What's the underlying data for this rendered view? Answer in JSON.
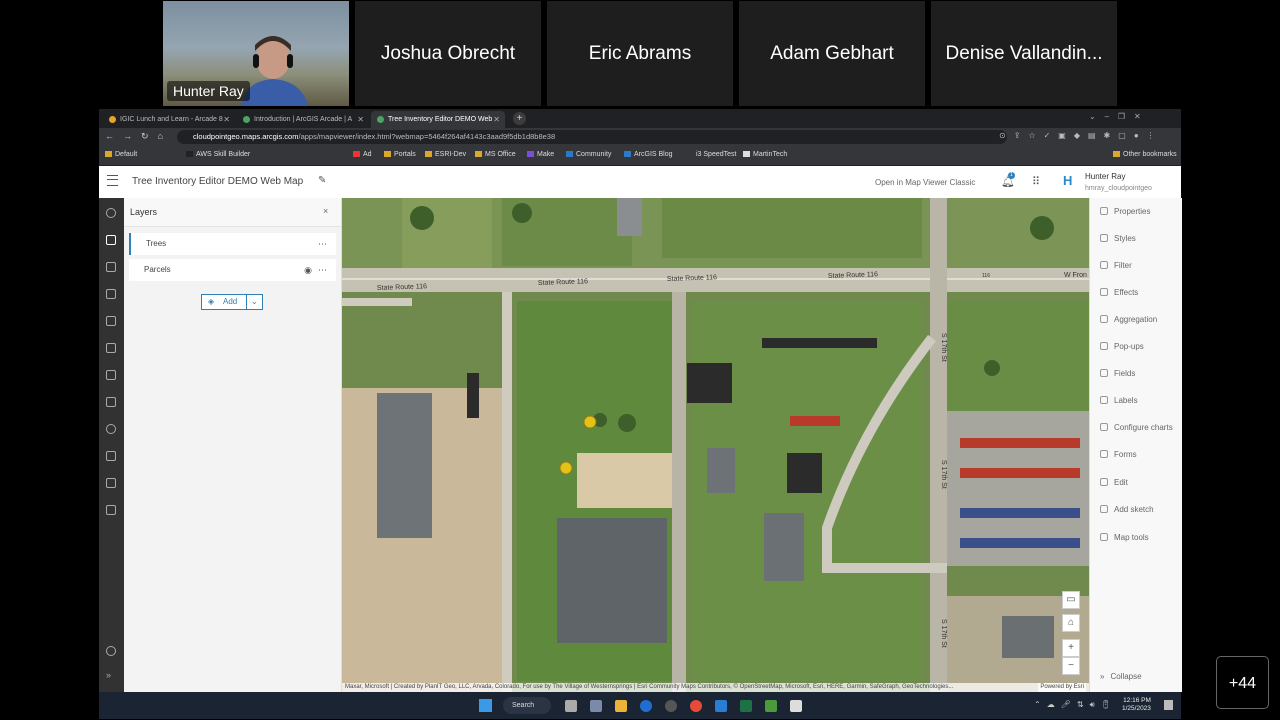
{
  "meeting": {
    "self_name": "Hunter Ray",
    "participants": [
      "Joshua Obrecht",
      "Eric Abrams",
      "Adam Gebhart",
      "Denise Vallandin..."
    ],
    "more_count": "+44"
  },
  "browser": {
    "tabs": [
      {
        "title": "IGIC Lunch and Learn - Arcade 8",
        "active": false
      },
      {
        "title": "Introduction | ArcGIS Arcade | A",
        "active": false
      },
      {
        "title": "Tree Inventory Editor DEMO Web",
        "active": true
      }
    ],
    "url_domain": "cloudpointgeo.maps.arcgis.com",
    "url_path": "/apps/mapviewer/index.html?webmap=5464f264af4143c3aad9f5db1d8b8e38",
    "bookmarks": [
      "Default",
      "AWS Skill Builder",
      "Ad",
      "Portals",
      "ESRI-Dev",
      "MS Office",
      "Make",
      "Community",
      "ArcGIS Blog",
      "i3 SpeedTest",
      "MartinTech"
    ],
    "other_bookmarks": "Other bookmarks"
  },
  "app": {
    "title": "Tree Inventory Editor DEMO Web Map",
    "classic_link": "Open in Map Viewer Classic",
    "notification_count": "1",
    "user_name": "Hunter Ray",
    "user_id": "hmray_cloudpointgeo"
  },
  "layers_panel": {
    "title": "Layers",
    "layers": [
      {
        "name": "Trees",
        "selected": true
      },
      {
        "name": "Parcels",
        "selected": false
      }
    ],
    "add_label": "Add"
  },
  "map": {
    "road_labels": [
      "State Route 116",
      "State Route 116",
      "State Route 116",
      "State Route 116",
      "W Fron",
      "116",
      "S 17th St",
      "S 17th St",
      "S 17th St"
    ],
    "attribution": "Maxar, Microsoft | Created by PlanIT Geo, LLC, Arvada, Colorado, For use by The Village of Westernsprings | Esri Community Maps Contributors, © OpenStreetMap, Microsoft, Esri, HERE, Garmin, SafeGraph, GeoTechnologies...",
    "powered_by": "Powered by Esri"
  },
  "right_panel": {
    "items": [
      "Properties",
      "Styles",
      "Filter",
      "Effects",
      "Aggregation",
      "Pop-ups",
      "Fields",
      "Labels",
      "Configure charts",
      "Forms",
      "Edit",
      "Add sketch",
      "Map tools"
    ],
    "collapse": "Collapse"
  },
  "taskbar": {
    "search": "Search",
    "time": "12:16 PM",
    "date": "1/25/2023"
  }
}
